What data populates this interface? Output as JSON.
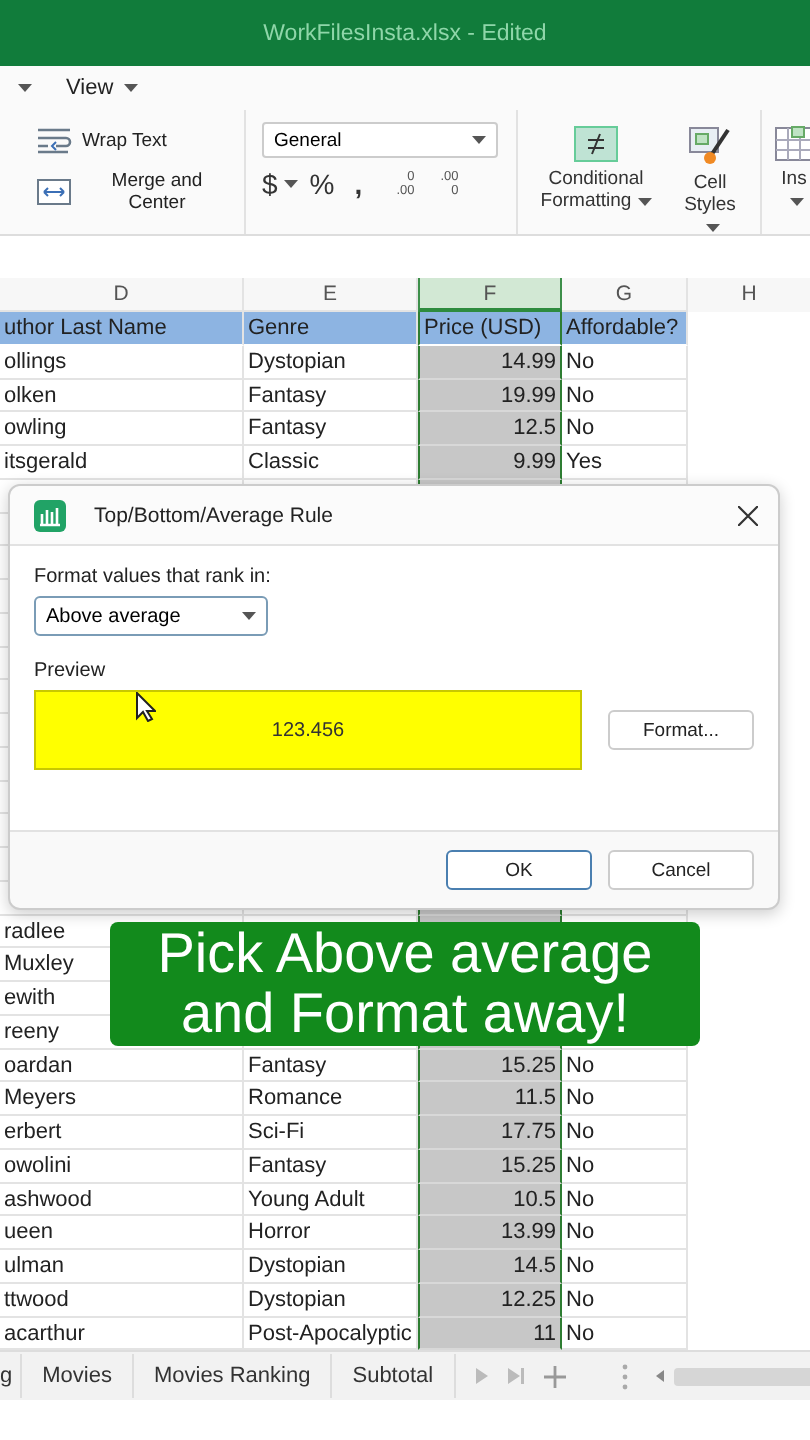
{
  "window": {
    "title": "WorkFilesInsta.xlsx - Edited"
  },
  "menu": {
    "items": [
      {
        "label": "View"
      }
    ]
  },
  "ribbon": {
    "alignment": [
      {
        "kind": "wrap",
        "label": "Wrap Text"
      },
      {
        "kind": "merge",
        "label": "Merge and Center"
      }
    ],
    "number": {
      "format": "General",
      "currency": "$",
      "percent": "%",
      "comma": ",",
      "increase_decimal": [
        "0",
        ".00"
      ],
      "decrease_decimal": [
        ".00",
        "0"
      ]
    },
    "styles": [
      {
        "kind": "conditional",
        "label": "Conditional Formatting"
      },
      {
        "kind": "cell_styles",
        "label": "Cell Styles"
      },
      {
        "kind": "insert",
        "label": "Ins"
      }
    ]
  },
  "sheet": {
    "columns": [
      {
        "letter": "D",
        "selected": false
      },
      {
        "letter": "E",
        "selected": false
      },
      {
        "letter": "F",
        "selected": true
      },
      {
        "letter": "G",
        "selected": false
      },
      {
        "letter": "H",
        "selected": false
      }
    ],
    "header": [
      "uthor Last Name",
      "Genre",
      "Price (USD)",
      "Affordable?"
    ],
    "rows_above": [
      {
        "author": "ollings",
        "genre": "Dystopian",
        "price": "14.99",
        "affordable": "No"
      },
      {
        "author": "olken",
        "genre": "Fantasy",
        "price": "19.99",
        "affordable": "No"
      },
      {
        "author": "owling",
        "genre": "Fantasy",
        "price": "12.5",
        "affordable": "No"
      },
      {
        "author": "itsgerald",
        "genre": "Classic",
        "price": "9.99",
        "affordable": "Yes"
      }
    ],
    "rows_below": [
      {
        "author": "radlee"
      },
      {
        "author": "Muxley"
      },
      {
        "author": "ewith"
      },
      {
        "author": "reeny"
      },
      {
        "author": "oardan",
        "genre": "Fantasy",
        "price": "15.25",
        "affordable": "No"
      },
      {
        "author": "Meyers",
        "genre": "Romance",
        "price": "11.5",
        "affordable": "No"
      },
      {
        "author": "erbert",
        "genre": "Sci-Fi",
        "price": "17.75",
        "affordable": "No"
      },
      {
        "author": "owolini",
        "genre": "Fantasy",
        "price": "15.25",
        "affordable": "No"
      },
      {
        "author": "ashwood",
        "genre": "Young Adult",
        "price": "10.5",
        "affordable": "No"
      },
      {
        "author": "ueen",
        "genre": "Horror",
        "price": "13.99",
        "affordable": "No"
      },
      {
        "author": "ulman",
        "genre": "Dystopian",
        "price": "14.5",
        "affordable": "No"
      },
      {
        "author": "ttwood",
        "genre": "Dystopian",
        "price": "12.25",
        "affordable": "No"
      },
      {
        "author": "acarthur",
        "genre": "Post-Apocalyptic",
        "price": "11",
        "affordable": "No"
      }
    ]
  },
  "sheet_tabs": [
    {
      "label": "g"
    },
    {
      "label": "Movies"
    },
    {
      "label": "Movies Ranking"
    },
    {
      "label": "Subtotal"
    }
  ],
  "dialog": {
    "title": "Top/Bottom/Average Rule",
    "rank_label": "Format values that rank in:",
    "rank_value": "Above average",
    "preview_label": "Preview",
    "preview_text": "123.456",
    "format_button": "Format...",
    "buttons": [
      {
        "label": "OK",
        "default": true
      },
      {
        "label": "Cancel",
        "default": false
      }
    ]
  },
  "caption": {
    "lines": [
      "Pick Above average",
      "and Format away!"
    ]
  }
}
